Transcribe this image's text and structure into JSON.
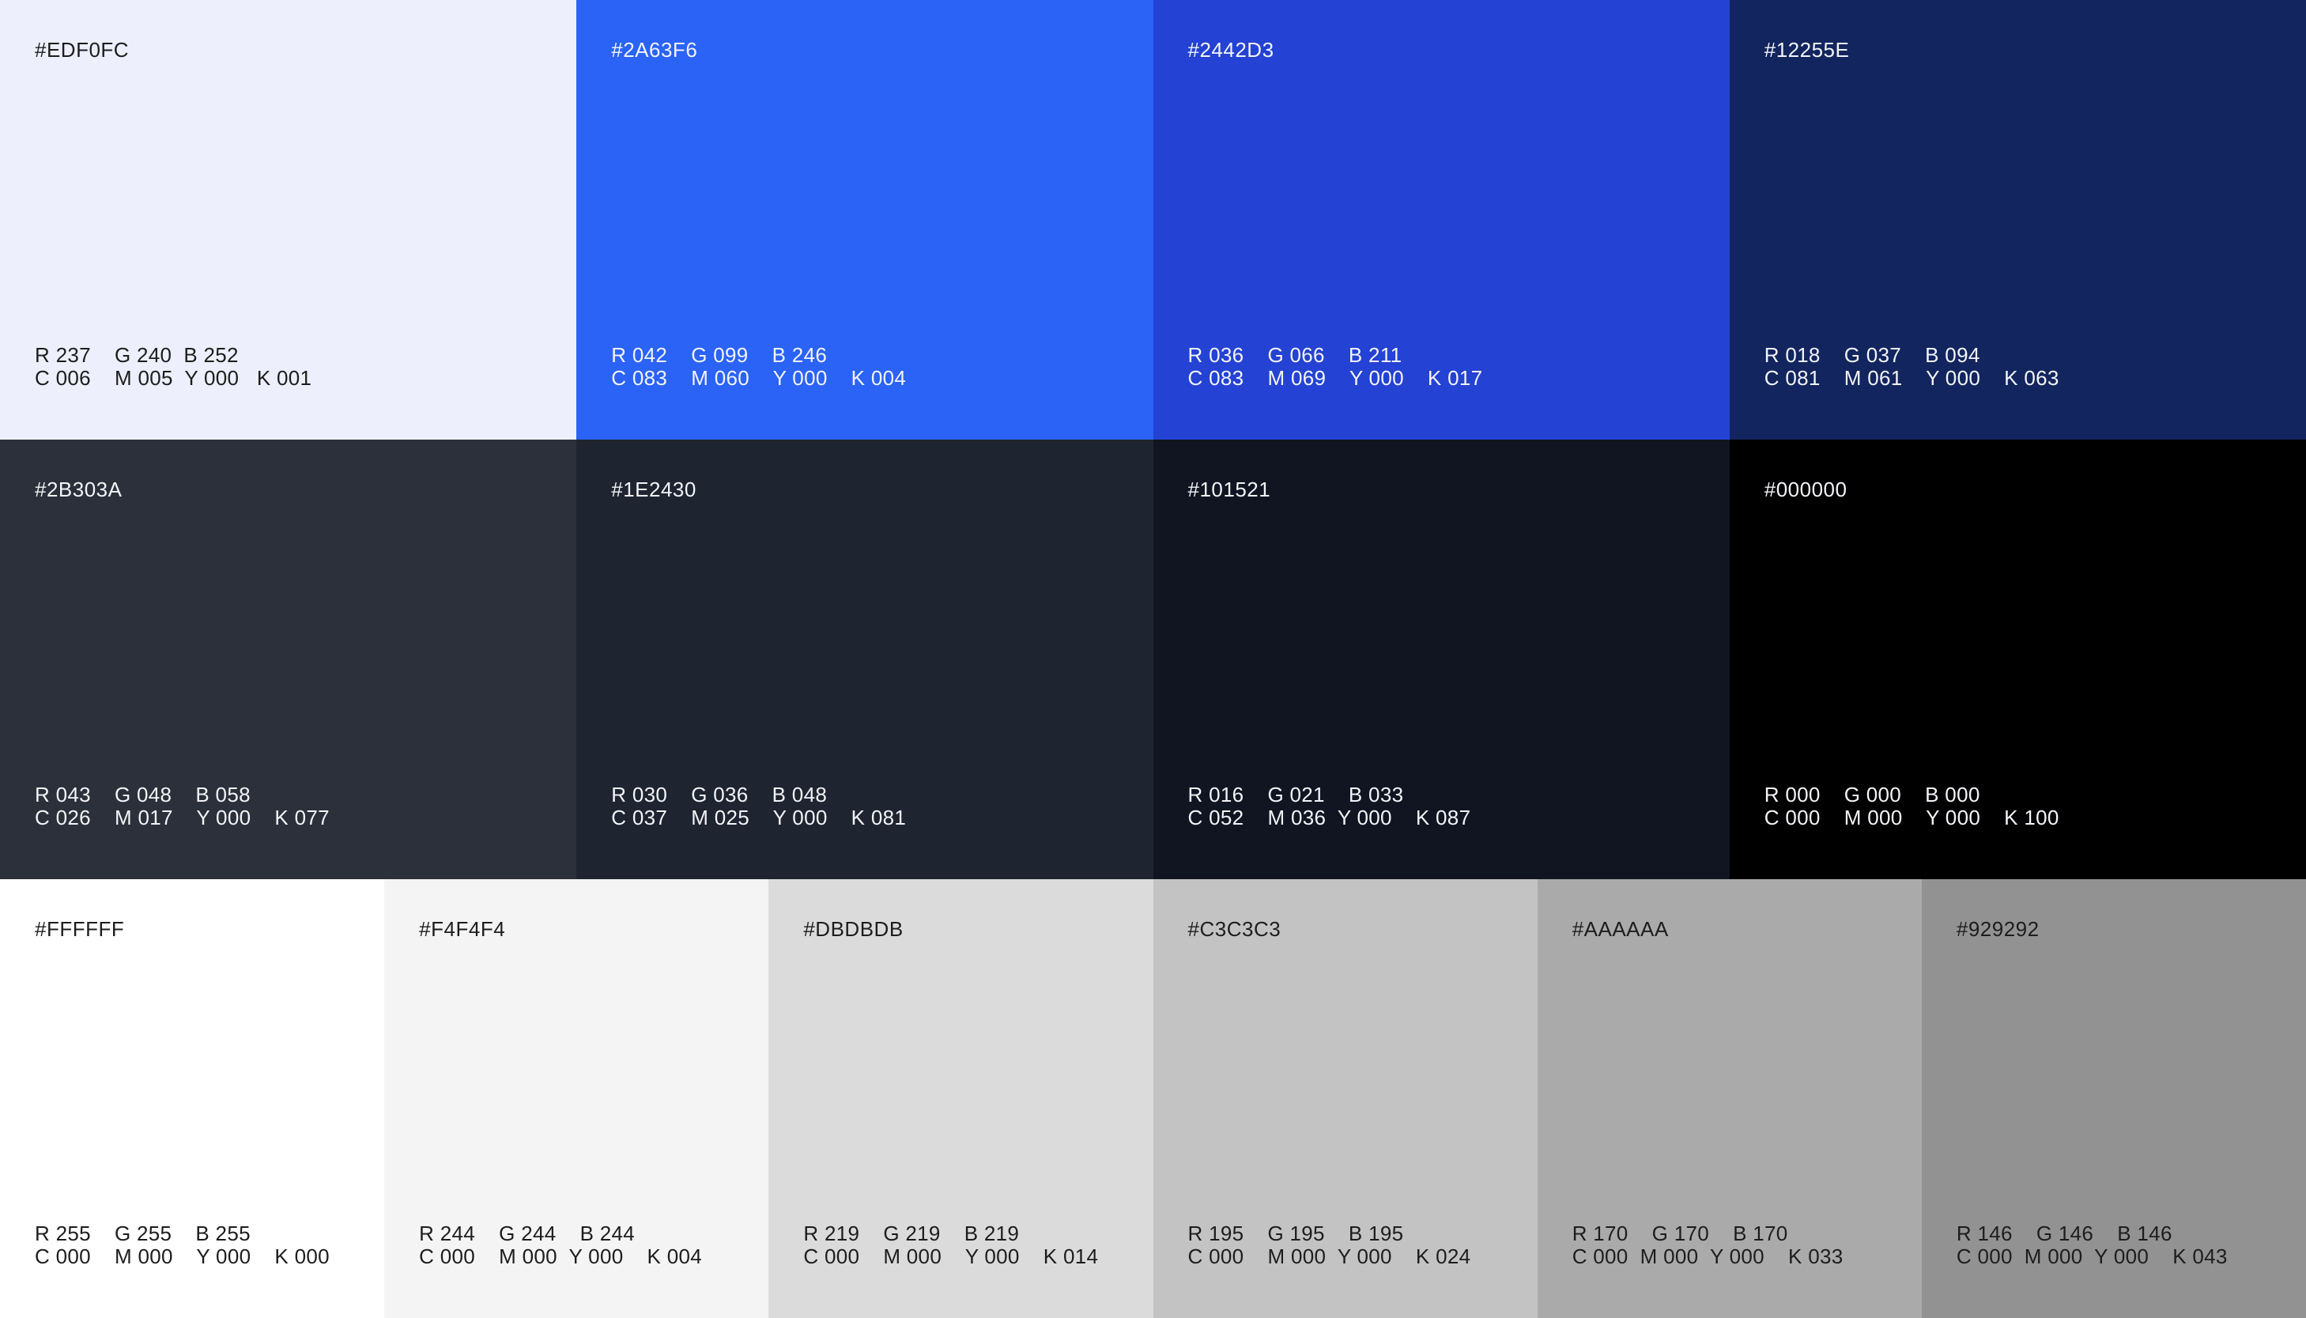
{
  "rows": [
    [
      {
        "hex": "#EDF0FC",
        "rgb": "R 237    G 240  B 252",
        "cmyk": "C 006    M 005  Y 000   K 001",
        "color": "#EDF0FC",
        "text": "light"
      },
      {
        "hex": "#2A63F6",
        "rgb": "R 042    G 099    B 246",
        "cmyk": "C 083    M 060    Y 000    K 004",
        "color": "#2A63F6",
        "text": "dark"
      },
      {
        "hex": "#2442D3",
        "rgb": "R 036    G 066    B 211",
        "cmyk": "C 083    M 069    Y 000    K 017",
        "color": "#2442D3",
        "text": "dark"
      },
      {
        "hex": "#12255E",
        "rgb": "R 018    G 037    B 094",
        "cmyk": "C 081    M 061    Y 000    K 063",
        "color": "#12255E",
        "text": "dark"
      }
    ],
    [
      {
        "hex": "#2B303A",
        "rgb": "R 043    G 048    B 058",
        "cmyk": "C 026    M 017    Y 000    K 077",
        "color": "#2B303A",
        "text": "dark"
      },
      {
        "hex": "#1E2430",
        "rgb": "R 030    G 036    B 048",
        "cmyk": "C 037    M 025    Y 000    K 081",
        "color": "#1E2430",
        "text": "dark"
      },
      {
        "hex": "#101521",
        "rgb": "R 016    G 021    B 033",
        "cmyk": "C 052    M 036  Y 000    K 087",
        "color": "#101521",
        "text": "dark"
      },
      {
        "hex": "#000000",
        "rgb": "R 000    G 000    B 000",
        "cmyk": "C 000    M 000    Y 000    K 100",
        "color": "#000000",
        "text": "dark"
      }
    ],
    [
      {
        "hex": "#FFFFFF",
        "rgb": "R 255    G 255    B 255",
        "cmyk": "C 000    M 000    Y 000    K 000",
        "color": "#FFFFFF",
        "text": "light"
      },
      {
        "hex": "#F4F4F4",
        "rgb": "R 244    G 244    B 244",
        "cmyk": "C 000    M 000  Y 000    K 004",
        "color": "#F4F4F4",
        "text": "light"
      },
      {
        "hex": "#DBDBDB",
        "rgb": "R 219    G 219    B 219",
        "cmyk": "C 000    M 000    Y 000    K 014",
        "color": "#DBDBDB",
        "text": "light"
      },
      {
        "hex": "#C3C3C3",
        "rgb": "R 195    G 195    B 195",
        "cmyk": "C 000    M 000  Y 000    K 024",
        "color": "#C3C3C3",
        "text": "light"
      },
      {
        "hex": "#AAAAAA",
        "rgb": "R 170    G 170    B 170",
        "cmyk": "C 000  M 000  Y 000    K 033",
        "color": "#AAAAAA",
        "text": "light"
      },
      {
        "hex": "#929292",
        "rgb": "R 146    G 146    B 146",
        "cmyk": "C 000  M 000  Y 000    K 043",
        "color": "#929292",
        "text": "light"
      }
    ]
  ]
}
